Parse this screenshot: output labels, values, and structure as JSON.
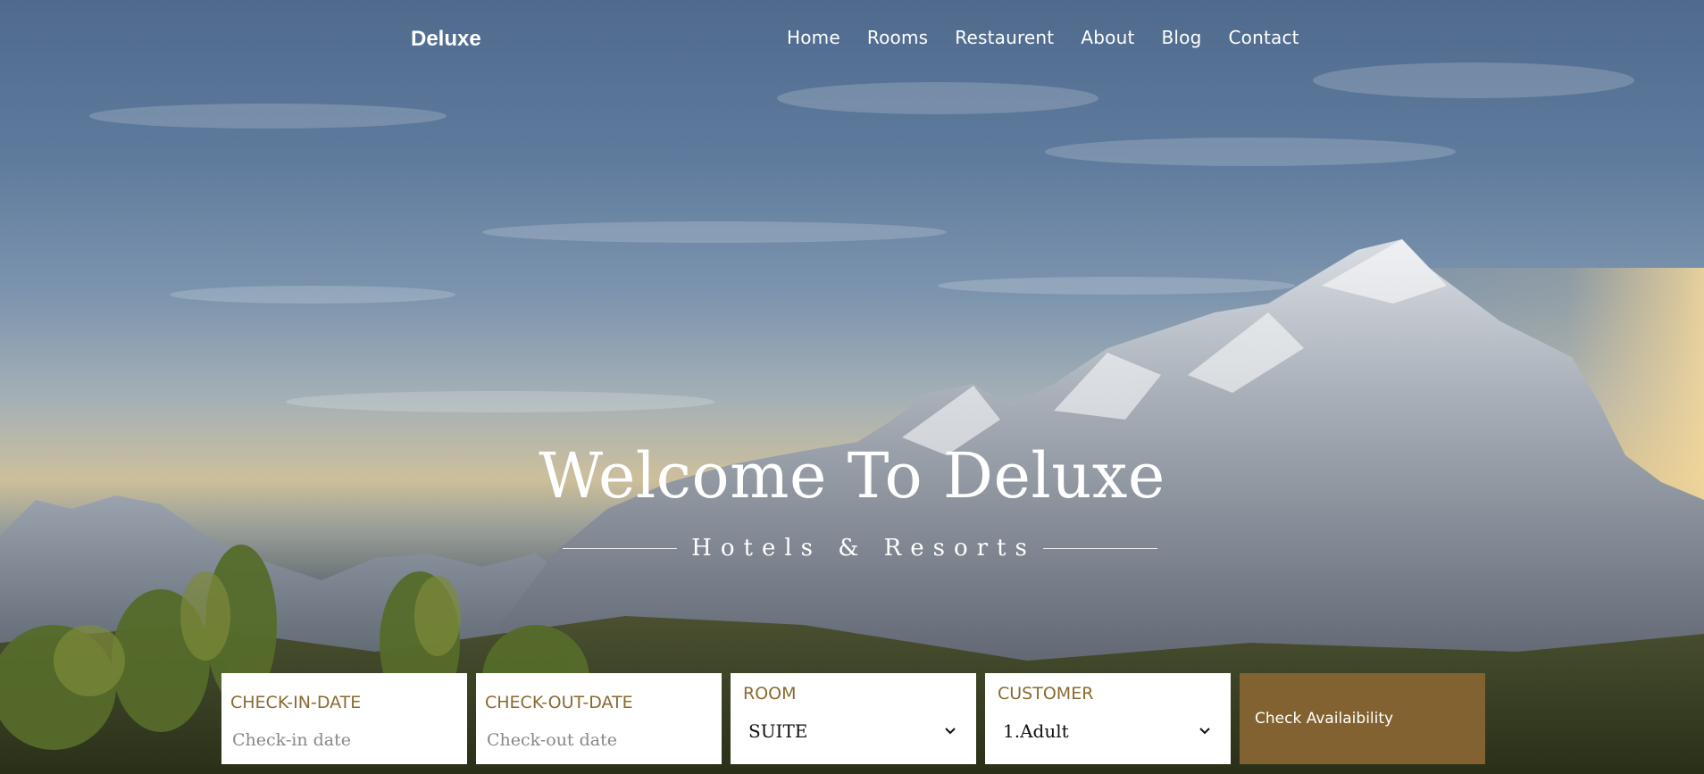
{
  "brand": "Deluxe",
  "nav": {
    "items": [
      "Home",
      "Rooms",
      "Restaurent",
      "About",
      "Blog",
      "Contact"
    ]
  },
  "hero": {
    "title": "Welcome To Deluxe",
    "subtitle": "Hotels & Resorts"
  },
  "booking": {
    "checkin": {
      "label": "CHECK-IN-DATE",
      "placeholder": "Check-in date"
    },
    "checkout": {
      "label": "CHECK-OUT-DATE",
      "placeholder": "Check-out date"
    },
    "room": {
      "label": "ROOM",
      "value": "SUITE"
    },
    "customer": {
      "label": "CUSTOMER",
      "value": "1.Adult"
    },
    "button": "Check Availaibility"
  },
  "colors": {
    "accent": "#826230",
    "label": "#8a6a30"
  }
}
